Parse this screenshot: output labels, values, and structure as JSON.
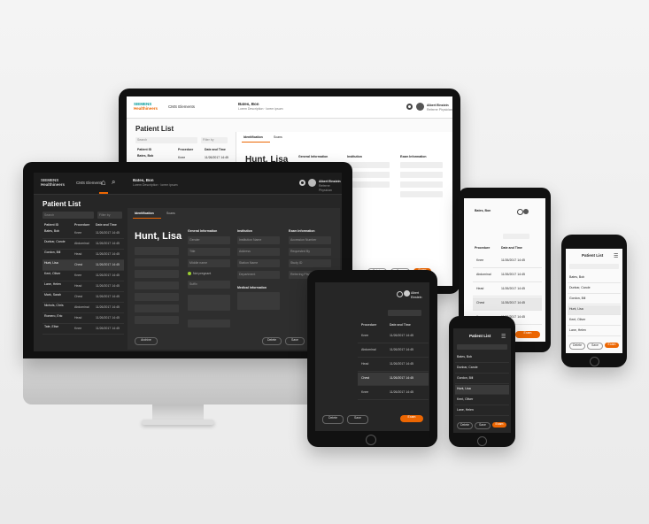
{
  "brand": {
    "line1": "SIEMENS",
    "line2": "Healthineers"
  },
  "app": {
    "name": "CMS Elements"
  },
  "page": {
    "title": "Patient List"
  },
  "user": {
    "name": "Albert Einstein",
    "role": "Referrer Physician"
  },
  "patient_header": {
    "name": "Bates, Bon",
    "info": "Lorem Description · lorem ipsum"
  },
  "tabs": {
    "identification": "Identification",
    "scans": "Scans"
  },
  "patient": {
    "name": "Hunt, Lisa"
  },
  "sections": {
    "general": "General Information",
    "institution": "Institution",
    "exam": "Exam Information",
    "medical": "Medical Information"
  },
  "columns": {
    "patient_id": "Patient ID",
    "procedure": "Procedure",
    "date": "Date and Time"
  },
  "patients": [
    {
      "name": "Bates, Bob",
      "procedure": "Knee",
      "date": "11/26/2017 14:45"
    },
    {
      "name": "Dunbar, Carole",
      "procedure": "Abdominal",
      "date": "11/26/2017 14:45"
    },
    {
      "name": "Gordon, Bill",
      "procedure": "Head",
      "date": "11/26/2017 14:45"
    },
    {
      "name": "Hunt, Lisa",
      "procedure": "Chest",
      "date": "11/26/2017 14:45"
    },
    {
      "name": "Kent, Oliver",
      "procedure": "Knee",
      "date": "11/26/2017 14:45"
    },
    {
      "name": "Lane, Helen",
      "procedure": "Head",
      "date": "11/26/2017 14:45"
    },
    {
      "name": "Mark, Sarah",
      "procedure": "Chest",
      "date": "11/26/2017 14:45"
    },
    {
      "name": "Nichols, Chris",
      "procedure": "Abdominal",
      "date": "11/26/2017 14:45"
    },
    {
      "name": "Romero, Eric",
      "procedure": "Head",
      "date": "11/26/2017 14:45"
    },
    {
      "name": "Tate, Elise",
      "procedure": "Knee",
      "date": "11/26/2017 14:45"
    }
  ],
  "actions": {
    "delete": "Delete",
    "save": "Save",
    "exam": "Exam",
    "archive": "Archive"
  },
  "search": {
    "placeholder": "Search",
    "filter": "Filter by"
  },
  "general_fields": [
    "Gender",
    "Title",
    "Middle name",
    "Suffix",
    "Date of birth",
    "Age",
    "Weight",
    "Height"
  ],
  "exam_fields": [
    "Accession Number",
    "Requested By",
    "Study ID",
    "Referring Physician",
    "Study Comment"
  ],
  "institution_fields": [
    "Institution Name",
    "Address",
    "Station Name",
    "Department"
  ],
  "pregnancy": "Not pregnant",
  "colors": {
    "accent": "#ec6602",
    "brand": "#009999"
  }
}
